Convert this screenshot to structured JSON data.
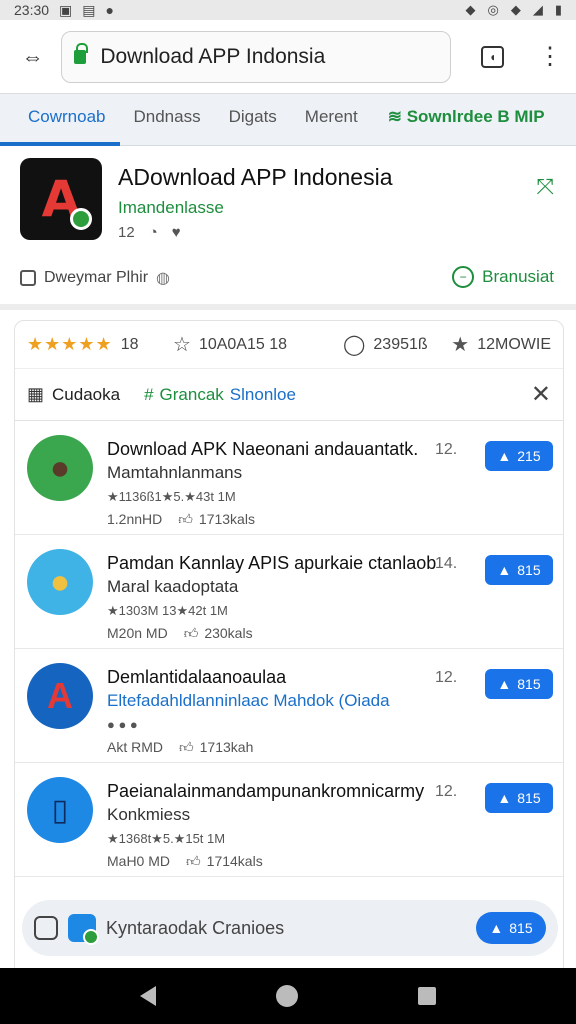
{
  "status_bar": {
    "time": "23:30",
    "icons": [
      "image-icon",
      "download-icon",
      "dot-icon"
    ],
    "right_icons": [
      "location-icon",
      "alarm-icon",
      "wifi-icon",
      "signal-icon",
      "battery-icon"
    ]
  },
  "browser": {
    "url_text": "Download APP Indonsia"
  },
  "tabs": [
    {
      "label": "Cowrnoab",
      "active": true
    },
    {
      "label": "Dndnass",
      "active": false
    },
    {
      "label": "Digats",
      "active": false
    },
    {
      "label": "Merent",
      "active": false
    },
    {
      "label": "Sownlrdee B MIP",
      "active": false,
      "promo": true
    }
  ],
  "app": {
    "title": "ADownload APP Indonesia",
    "subtitle": "Imandenlasse",
    "meta_num": "12",
    "footer_left": "Dweymar Plhir",
    "footer_right": "Branusiat"
  },
  "stats": {
    "stars": "★★★★★",
    "rating_count": "18",
    "star_label": "10A0A15 18",
    "comments": "23951ß",
    "favorites": "12MOWIE"
  },
  "filter": {
    "label": "Cudaoka",
    "green_text": "Grancak",
    "blue_text": "Slnonloe"
  },
  "list": [
    {
      "title": "Download APK Naeonani andauantatk.",
      "num": "12.",
      "sub": "Mamtahnlanmans",
      "rating": "★1136ß1★5.★43t 1M",
      "size": "1.2nnHD",
      "likes": "1713kals",
      "btn": "215",
      "avatar_color": "#3aa64d"
    },
    {
      "title": "Pamdan Kannlay APIS apurkaie ctanlaob",
      "num": "14.",
      "sub": "Maral kaadoptata",
      "rating": "★1303M 13★42t 1M",
      "size": "M20n MD",
      "likes": "230kals",
      "btn": "815",
      "avatar_color": "#3fb3e6"
    },
    {
      "title": "Demlantidalaanoaulaa",
      "num": "12.",
      "sub": "Eltefadahldlanninlaac Mahdok (Oiada",
      "rating": "",
      "size": "Akt RMD",
      "likes": "1713kah",
      "btn": "815",
      "avatar_color": "#1565c0"
    },
    {
      "title": "Paeianalainmandampunankromnicarmy",
      "num": "12.",
      "sub": "Konkmiess",
      "rating": "★1368t★5.★15t 1M",
      "size": "MaH0 MD",
      "likes": "1714kals",
      "btn": "815",
      "avatar_color": "#1e88e5"
    }
  ],
  "bottom_bar": {
    "text": "Kyntaraodak Cranioes",
    "btn": "815"
  },
  "colors": {
    "accent": "#1a73e8",
    "green": "#1e8e3e",
    "star": "#f0a020",
    "red": "#e53935"
  }
}
